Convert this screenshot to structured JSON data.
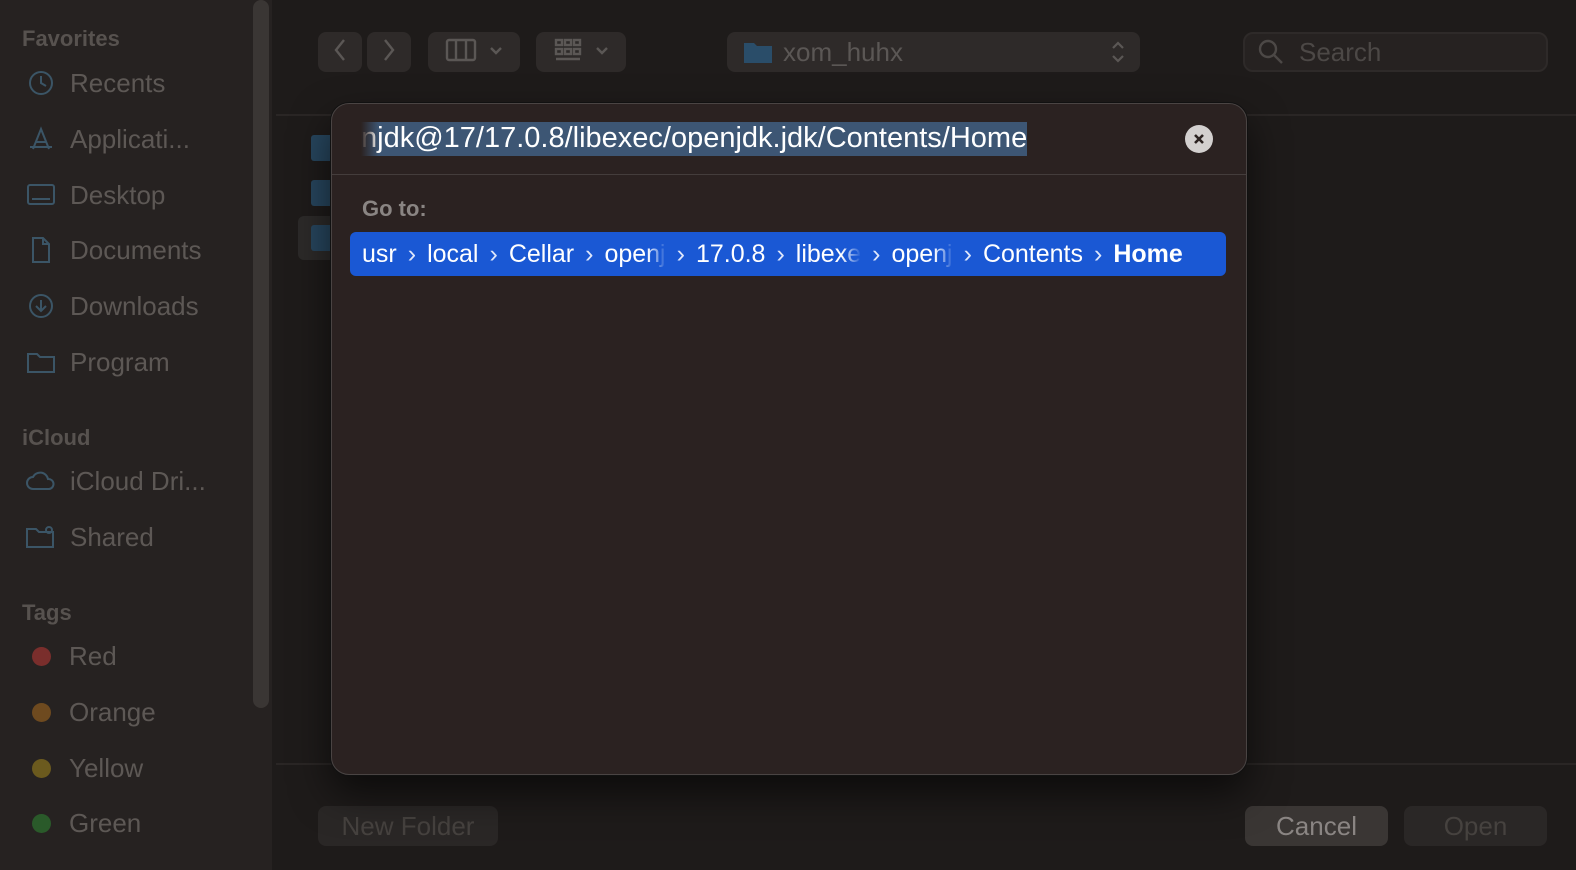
{
  "sidebar": {
    "favorites_header": "Favorites",
    "favorites": [
      {
        "label": "Recents",
        "icon": "clock-icon"
      },
      {
        "label": "Applicati...",
        "icon": "applications-icon"
      },
      {
        "label": "Desktop",
        "icon": "desktop-icon"
      },
      {
        "label": "Documents",
        "icon": "document-icon"
      },
      {
        "label": "Downloads",
        "icon": "download-icon"
      },
      {
        "label": "Program",
        "icon": "folder-icon"
      }
    ],
    "icloud_header": "iCloud",
    "icloud": [
      {
        "label": "iCloud Dri...",
        "icon": "cloud-icon"
      },
      {
        "label": "Shared",
        "icon": "shared-folder-icon"
      }
    ],
    "tags_header": "Tags",
    "tags": [
      {
        "label": "Red",
        "color": "#7a2e2c"
      },
      {
        "label": "Orange",
        "color": "#6e4a1f"
      },
      {
        "label": "Yellow",
        "color": "#6b5a1e"
      },
      {
        "label": "Green",
        "color": "#2a5a2a"
      }
    ]
  },
  "toolbar": {
    "location": "xom_huhx",
    "search_placeholder": "Search"
  },
  "dialog": {
    "path_input": "njdk@17/17.0.8/libexec/openjdk.jdk/Contents/Home",
    "goto_label": "Go to:",
    "breadcrumbs": [
      "usr",
      "local",
      "Cellar",
      "openj",
      "17.0.8",
      "libexe",
      "openj",
      "Contents",
      "Home"
    ]
  },
  "buttons": {
    "new_folder": "New Folder",
    "cancel": "Cancel",
    "open": "Open"
  },
  "colors": {
    "accent": "#1a58d4",
    "selection": "#3d5674"
  }
}
